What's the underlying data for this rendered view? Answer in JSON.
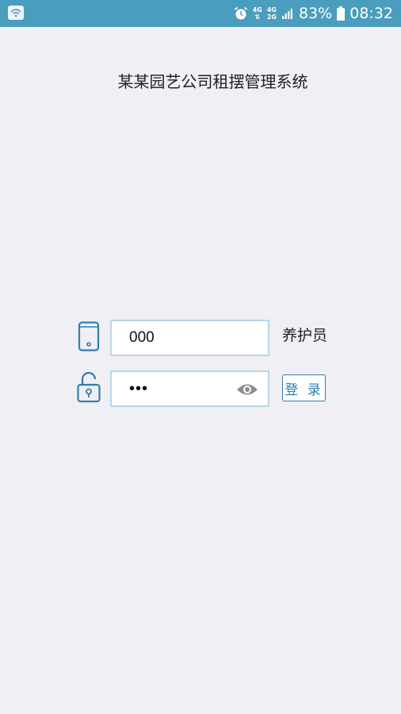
{
  "status_bar": {
    "network_top": "4G",
    "network_top2": "4G",
    "network_bottom2": "2G",
    "battery_percent": "83%",
    "time": "08:32",
    "icons": [
      "wifi-icon",
      "alarm-icon",
      "signal-icon",
      "battery-icon"
    ]
  },
  "app": {
    "title": "某某园艺公司租摆管理系统"
  },
  "login": {
    "account_value": "000",
    "password_masked": "•••",
    "role_label": "养护员",
    "login_button": "登 录"
  },
  "colors": {
    "status_bar": "#4b9dbd",
    "background": "#efeff4",
    "accent": "#2e7fb0",
    "field_border": "#b9d7e6"
  }
}
